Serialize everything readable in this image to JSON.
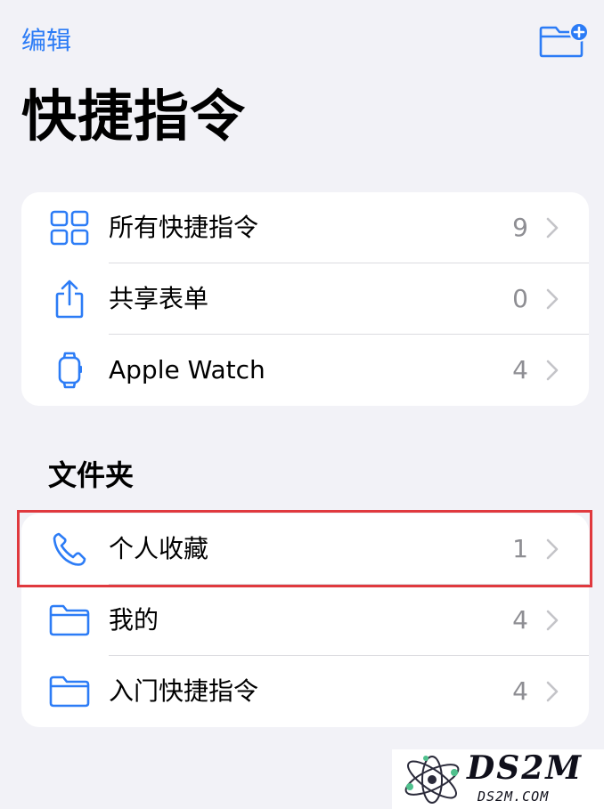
{
  "nav": {
    "edit_label": "编辑",
    "new_folder_icon": "folder-plus-icon"
  },
  "title": "快捷指令",
  "top_list": [
    {
      "label": "所有快捷指令",
      "count": "9",
      "icon": "grid-icon"
    },
    {
      "label": "共享表单",
      "count": "0",
      "icon": "share-icon"
    },
    {
      "label": "Apple Watch",
      "count": "4",
      "icon": "watch-icon"
    }
  ],
  "folders_section": {
    "header": "文件夹",
    "items": [
      {
        "label": "个人收藏",
        "count": "1",
        "icon": "phone-icon"
      },
      {
        "label": "我的",
        "count": "4",
        "icon": "folder-icon"
      },
      {
        "label": "入门快捷指令",
        "count": "4",
        "icon": "folder-icon"
      }
    ]
  },
  "watermark": {
    "title": "DS2M",
    "subtitle": "DS2M.COM"
  },
  "colors": {
    "accent": "#2c7cf6",
    "highlight": "#e0393e",
    "background": "#f2f2f7"
  }
}
